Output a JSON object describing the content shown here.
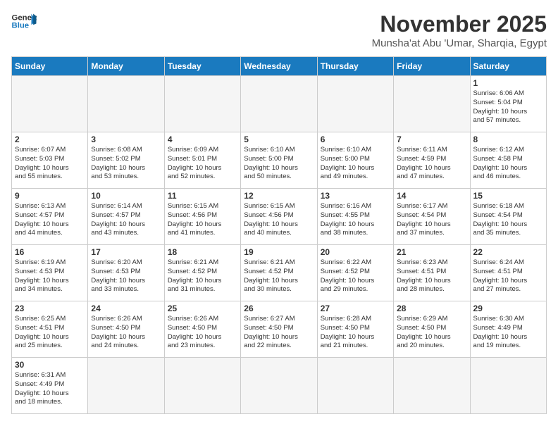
{
  "header": {
    "logo_general": "General",
    "logo_blue": "Blue",
    "month_title": "November 2025",
    "subtitle": "Munsha'at Abu 'Umar, Sharqia, Egypt"
  },
  "days_of_week": [
    "Sunday",
    "Monday",
    "Tuesday",
    "Wednesday",
    "Thursday",
    "Friday",
    "Saturday"
  ],
  "weeks": [
    [
      {
        "day": "",
        "info": ""
      },
      {
        "day": "",
        "info": ""
      },
      {
        "day": "",
        "info": ""
      },
      {
        "day": "",
        "info": ""
      },
      {
        "day": "",
        "info": ""
      },
      {
        "day": "",
        "info": ""
      },
      {
        "day": "1",
        "info": "Sunrise: 6:06 AM\nSunset: 5:04 PM\nDaylight: 10 hours\nand 57 minutes."
      }
    ],
    [
      {
        "day": "2",
        "info": "Sunrise: 6:07 AM\nSunset: 5:03 PM\nDaylight: 10 hours\nand 55 minutes."
      },
      {
        "day": "3",
        "info": "Sunrise: 6:08 AM\nSunset: 5:02 PM\nDaylight: 10 hours\nand 53 minutes."
      },
      {
        "day": "4",
        "info": "Sunrise: 6:09 AM\nSunset: 5:01 PM\nDaylight: 10 hours\nand 52 minutes."
      },
      {
        "day": "5",
        "info": "Sunrise: 6:10 AM\nSunset: 5:00 PM\nDaylight: 10 hours\nand 50 minutes."
      },
      {
        "day": "6",
        "info": "Sunrise: 6:10 AM\nSunset: 5:00 PM\nDaylight: 10 hours\nand 49 minutes."
      },
      {
        "day": "7",
        "info": "Sunrise: 6:11 AM\nSunset: 4:59 PM\nDaylight: 10 hours\nand 47 minutes."
      },
      {
        "day": "8",
        "info": "Sunrise: 6:12 AM\nSunset: 4:58 PM\nDaylight: 10 hours\nand 46 minutes."
      }
    ],
    [
      {
        "day": "9",
        "info": "Sunrise: 6:13 AM\nSunset: 4:57 PM\nDaylight: 10 hours\nand 44 minutes."
      },
      {
        "day": "10",
        "info": "Sunrise: 6:14 AM\nSunset: 4:57 PM\nDaylight: 10 hours\nand 43 minutes."
      },
      {
        "day": "11",
        "info": "Sunrise: 6:15 AM\nSunset: 4:56 PM\nDaylight: 10 hours\nand 41 minutes."
      },
      {
        "day": "12",
        "info": "Sunrise: 6:15 AM\nSunset: 4:56 PM\nDaylight: 10 hours\nand 40 minutes."
      },
      {
        "day": "13",
        "info": "Sunrise: 6:16 AM\nSunset: 4:55 PM\nDaylight: 10 hours\nand 38 minutes."
      },
      {
        "day": "14",
        "info": "Sunrise: 6:17 AM\nSunset: 4:54 PM\nDaylight: 10 hours\nand 37 minutes."
      },
      {
        "day": "15",
        "info": "Sunrise: 6:18 AM\nSunset: 4:54 PM\nDaylight: 10 hours\nand 35 minutes."
      }
    ],
    [
      {
        "day": "16",
        "info": "Sunrise: 6:19 AM\nSunset: 4:53 PM\nDaylight: 10 hours\nand 34 minutes."
      },
      {
        "day": "17",
        "info": "Sunrise: 6:20 AM\nSunset: 4:53 PM\nDaylight: 10 hours\nand 33 minutes."
      },
      {
        "day": "18",
        "info": "Sunrise: 6:21 AM\nSunset: 4:52 PM\nDaylight: 10 hours\nand 31 minutes."
      },
      {
        "day": "19",
        "info": "Sunrise: 6:21 AM\nSunset: 4:52 PM\nDaylight: 10 hours\nand 30 minutes."
      },
      {
        "day": "20",
        "info": "Sunrise: 6:22 AM\nSunset: 4:52 PM\nDaylight: 10 hours\nand 29 minutes."
      },
      {
        "day": "21",
        "info": "Sunrise: 6:23 AM\nSunset: 4:51 PM\nDaylight: 10 hours\nand 28 minutes."
      },
      {
        "day": "22",
        "info": "Sunrise: 6:24 AM\nSunset: 4:51 PM\nDaylight: 10 hours\nand 27 minutes."
      }
    ],
    [
      {
        "day": "23",
        "info": "Sunrise: 6:25 AM\nSunset: 4:51 PM\nDaylight: 10 hours\nand 25 minutes."
      },
      {
        "day": "24",
        "info": "Sunrise: 6:26 AM\nSunset: 4:50 PM\nDaylight: 10 hours\nand 24 minutes."
      },
      {
        "day": "25",
        "info": "Sunrise: 6:26 AM\nSunset: 4:50 PM\nDaylight: 10 hours\nand 23 minutes."
      },
      {
        "day": "26",
        "info": "Sunrise: 6:27 AM\nSunset: 4:50 PM\nDaylight: 10 hours\nand 22 minutes."
      },
      {
        "day": "27",
        "info": "Sunrise: 6:28 AM\nSunset: 4:50 PM\nDaylight: 10 hours\nand 21 minutes."
      },
      {
        "day": "28",
        "info": "Sunrise: 6:29 AM\nSunset: 4:50 PM\nDaylight: 10 hours\nand 20 minutes."
      },
      {
        "day": "29",
        "info": "Sunrise: 6:30 AM\nSunset: 4:49 PM\nDaylight: 10 hours\nand 19 minutes."
      }
    ],
    [
      {
        "day": "30",
        "info": "Sunrise: 6:31 AM\nSunset: 4:49 PM\nDaylight: 10 hours\nand 18 minutes."
      },
      {
        "day": "",
        "info": ""
      },
      {
        "day": "",
        "info": ""
      },
      {
        "day": "",
        "info": ""
      },
      {
        "day": "",
        "info": ""
      },
      {
        "day": "",
        "info": ""
      },
      {
        "day": "",
        "info": ""
      }
    ]
  ]
}
